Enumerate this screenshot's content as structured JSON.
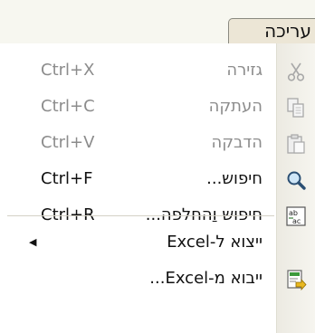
{
  "menu": {
    "title": "עריכה",
    "items": [
      {
        "label": "גזירה",
        "shortcut": "Ctrl+X",
        "icon": "scissors-icon",
        "enabled": false
      },
      {
        "label": "העתקה",
        "shortcut": "Ctrl+C",
        "icon": "copy-icon",
        "enabled": false
      },
      {
        "label": "הדבקה",
        "shortcut": "Ctrl+V",
        "icon": "paste-icon",
        "enabled": false
      },
      {
        "label": "חיפוש...",
        "shortcut": "Ctrl+F",
        "icon": "search-icon",
        "enabled": true
      },
      {
        "label_pre": "חיפוש ",
        "label_ul": "ו",
        "label_post": "החלפה...",
        "shortcut": "Ctrl+R",
        "icon": "find-replace-icon",
        "enabled": true
      },
      {
        "label": "ייצוא ל-Excel",
        "submenu_arrow": "◀",
        "enabled": true
      },
      {
        "label": "ייבוא מ-Excel...",
        "icon": "import-excel-icon",
        "enabled": true
      }
    ]
  }
}
